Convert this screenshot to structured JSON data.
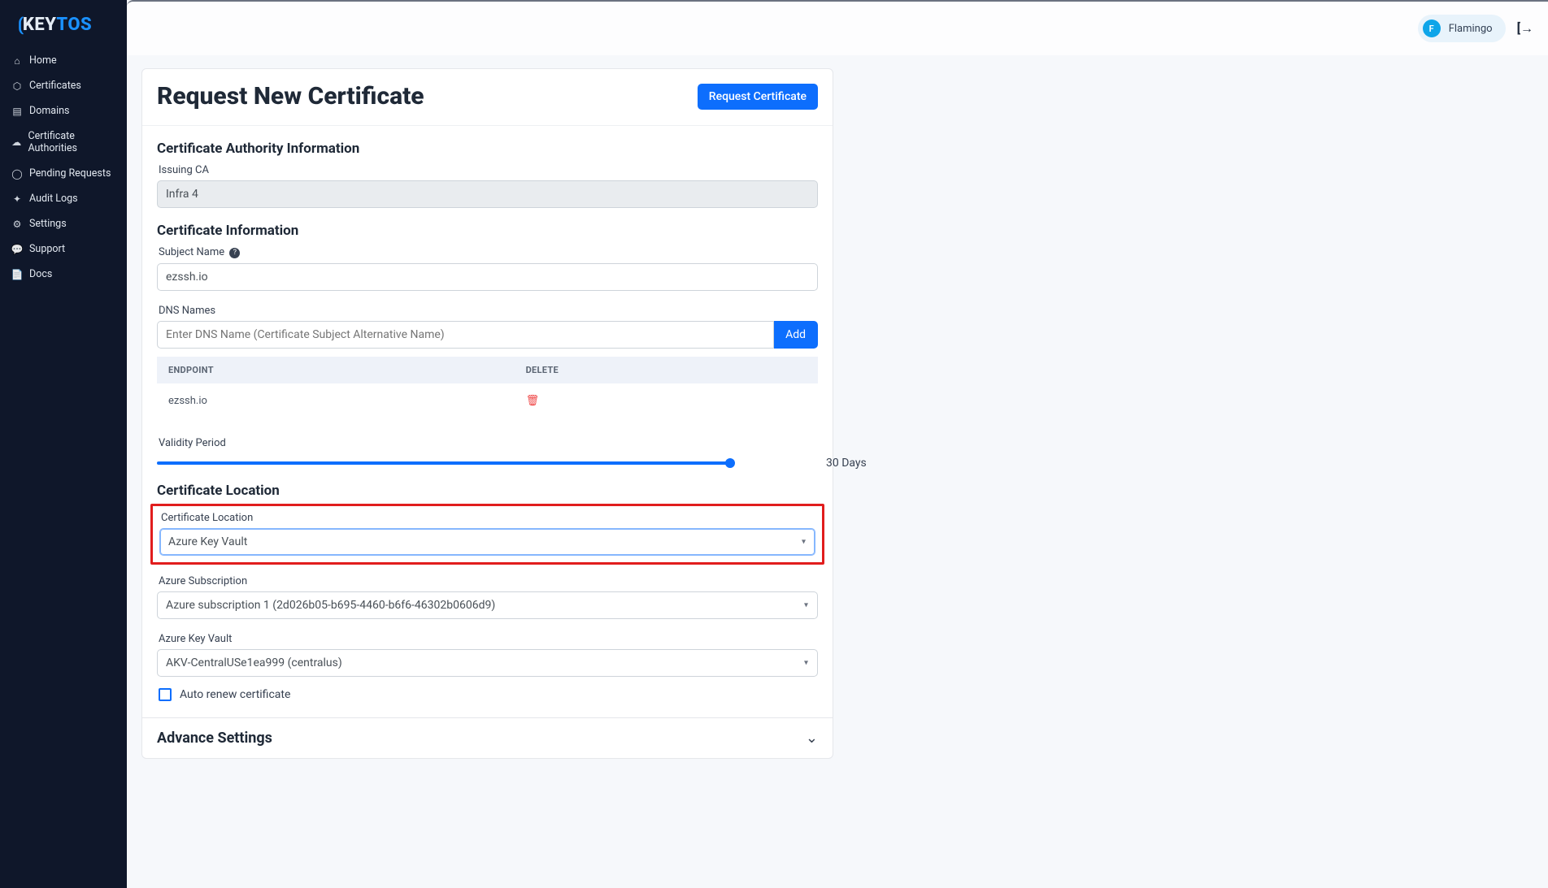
{
  "brand": {
    "part1": "KEY",
    "part2": "TOS"
  },
  "nav": {
    "items": [
      {
        "label": "Home",
        "icon": "⌂"
      },
      {
        "label": "Certificates",
        "icon": "⬡"
      },
      {
        "label": "Domains",
        "icon": "▤"
      },
      {
        "label": "Certificate Authorities",
        "icon": "☁"
      },
      {
        "label": "Pending Requests",
        "icon": "◯"
      },
      {
        "label": "Audit Logs",
        "icon": "✦"
      },
      {
        "label": "Settings",
        "icon": "⚙"
      },
      {
        "label": "Support",
        "icon": "💬"
      },
      {
        "label": "Docs",
        "icon": "📄"
      }
    ]
  },
  "user": {
    "initial": "F",
    "name": "Flamingo"
  },
  "page": {
    "title": "Request New Certificate",
    "request_btn": "Request Certificate",
    "sections": {
      "ca_info": {
        "title": "Certificate Authority Information",
        "issuing_ca_label": "Issuing CA",
        "issuing_ca_value": "Infra 4"
      },
      "cert_info": {
        "title": "Certificate Information",
        "subject_label": "Subject Name",
        "subject_value": "ezssh.io",
        "dns_label": "DNS Names",
        "dns_placeholder": "Enter DNS Name (Certificate Subject Alternative Name)",
        "add_btn": "Add",
        "table_headers": {
          "endpoint": "ENDPOINT",
          "delete": "DELETE"
        },
        "endpoints": [
          {
            "name": "ezssh.io"
          }
        ],
        "validity_label": "Validity Period",
        "validity_value": "30 Days"
      },
      "location": {
        "title": "Certificate Location",
        "location_label": "Certificate Location",
        "location_value": "Azure Key Vault",
        "subscription_label": "Azure Subscription",
        "subscription_value": "Azure subscription 1 (2d026b05-b695-4460-b6f6-46302b0606d9)",
        "keyvault_label": "Azure Key Vault",
        "keyvault_value": "AKV-CentralUSe1ea999 (centralus)",
        "autorenew_label": "Auto renew certificate"
      },
      "advanced": {
        "title": "Advance Settings"
      }
    }
  }
}
